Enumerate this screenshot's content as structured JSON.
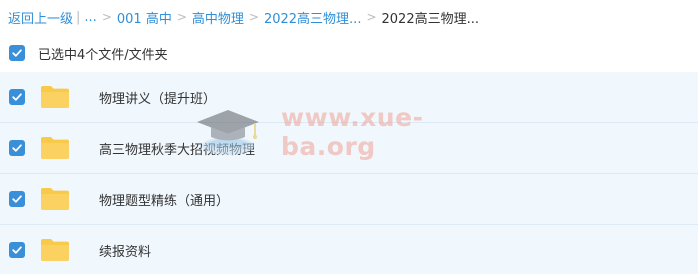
{
  "breadcrumb": {
    "back": "返回上一级",
    "divider": "|",
    "ellipsis": "...",
    "items": [
      "001 高中",
      "高中物理",
      "2022高三物理..."
    ],
    "current": "2022高三物理..."
  },
  "selection": {
    "label": "已选中4个文件/文件夹",
    "checked": true
  },
  "files": [
    {
      "name": "物理讲义（提升班）",
      "type": "folder",
      "checked": true
    },
    {
      "name": "高三物理秋季大招视频物理",
      "type": "folder",
      "checked": true
    },
    {
      "name": "物理题型精练（通用）",
      "type": "folder",
      "checked": true
    },
    {
      "name": "续报资料",
      "type": "folder",
      "checked": true
    }
  ],
  "watermark": {
    "text": "www.xue-ba.org"
  },
  "colors": {
    "accent": "#3a8fd9",
    "link": "#2f8fd8",
    "row_bg": "#f0f7fd",
    "folder": "#f9c94a"
  }
}
